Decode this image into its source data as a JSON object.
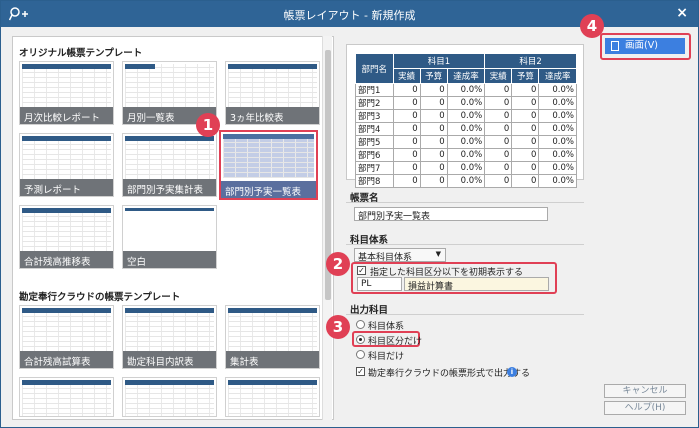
{
  "window": {
    "title": "帳票レイアウト - 新規作成",
    "close_label": "×"
  },
  "left": {
    "section1_title": "オリジナル帳票テンプレート",
    "section2_title": "勘定奉行クラウドの帳票テンプレート",
    "templates1": [
      "月次比較レポート",
      "月別一覧表",
      "3ヵ年比較表",
      "予測レポート",
      "部門別予実集計表",
      "部門別予実一覧表",
      "合計残高推移表",
      "空白"
    ],
    "templates2": [
      "合計残高試算表",
      "勘定科目内訳表",
      "集計表"
    ]
  },
  "preview": {
    "col0": "部門名",
    "group1": "科目1",
    "group2": "科目2",
    "sub": [
      "実績",
      "予算",
      "達成率"
    ],
    "rows": [
      {
        "name": "部門1",
        "v": [
          "0",
          "0",
          "0.0%",
          "0",
          "0",
          "0.0%"
        ]
      },
      {
        "name": "部門2",
        "v": [
          "0",
          "0",
          "0.0%",
          "0",
          "0",
          "0.0%"
        ]
      },
      {
        "name": "部門3",
        "v": [
          "0",
          "0",
          "0.0%",
          "0",
          "0",
          "0.0%"
        ]
      },
      {
        "name": "部門4",
        "v": [
          "0",
          "0",
          "0.0%",
          "0",
          "0",
          "0.0%"
        ]
      },
      {
        "name": "部門5",
        "v": [
          "0",
          "0",
          "0.0%",
          "0",
          "0",
          "0.0%"
        ]
      },
      {
        "name": "部門6",
        "v": [
          "0",
          "0",
          "0.0%",
          "0",
          "0",
          "0.0%"
        ]
      },
      {
        "name": "部門7",
        "v": [
          "0",
          "0",
          "0.0%",
          "0",
          "0",
          "0.0%"
        ]
      },
      {
        "name": "部門8",
        "v": [
          "0",
          "0",
          "0.0%",
          "0",
          "0",
          "0.0%"
        ]
      }
    ]
  },
  "form": {
    "report_name_label": "帳票名",
    "report_name_value": "部門別予実一覧表",
    "account_system_label": "科目体系",
    "account_system_value": "基本科目体系",
    "initial_display_label": "指定した科目区分以下を初期表示する",
    "code_value": "PL",
    "code_name": "損益計算書",
    "output_label": "出力科目",
    "radio1": "科目体系",
    "radio2": "科目区分だけ",
    "radio3": "科目だけ",
    "output_format_label": "勘定奉行クラウドの帳票形式で出力する"
  },
  "buttons": {
    "view": "画面(V)",
    "cancel": "キャンセル",
    "help": "ヘルプ(H)"
  },
  "badges": [
    "1",
    "2",
    "3",
    "4"
  ],
  "colors": {
    "titlebar": "#2f6496",
    "accent": "#e04055",
    "view_button": "#3c7fe0"
  }
}
